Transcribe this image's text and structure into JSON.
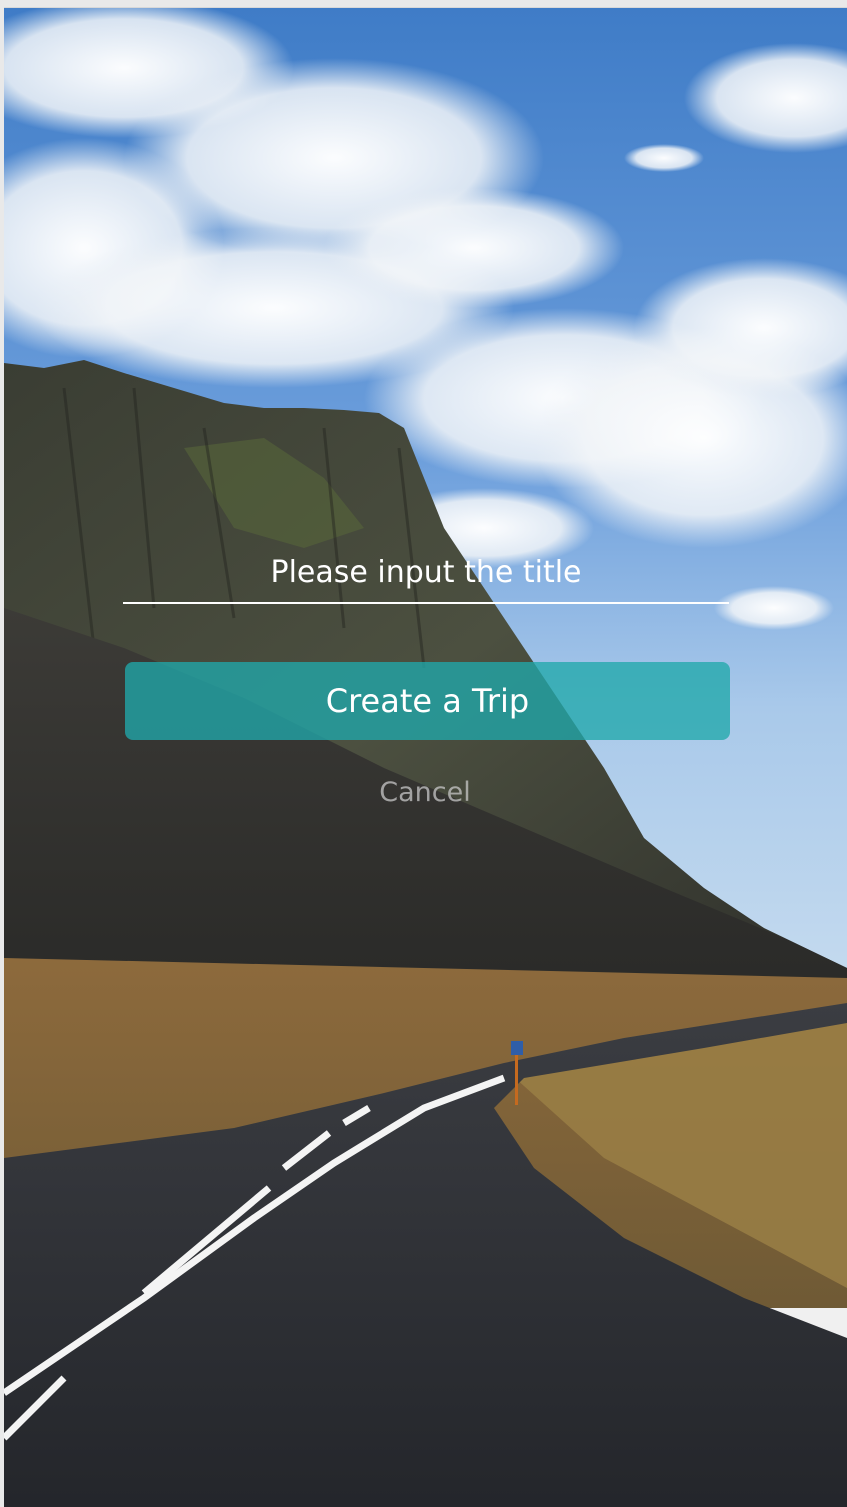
{
  "form": {
    "title_placeholder": "Please input the title",
    "title_value": "",
    "create_label": "Create a Trip",
    "cancel_label": "Cancel"
  },
  "background": {
    "description_icon": "landscape-photo"
  },
  "colors": {
    "create_button": "#20a8aa",
    "input_underline": "#ffffff",
    "cancel_text": "#c8c8c8"
  }
}
